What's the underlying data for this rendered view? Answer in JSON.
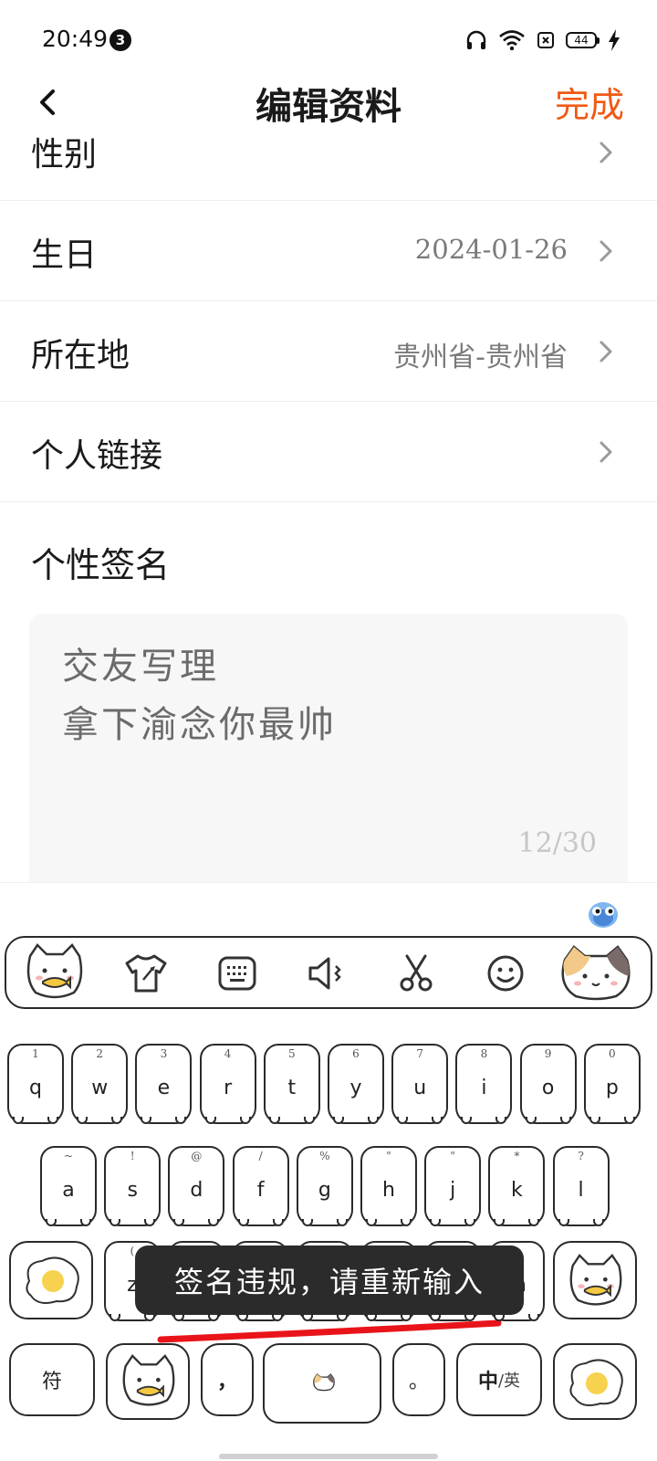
{
  "status_bar": {
    "time": "20:49",
    "notification_count": "3",
    "battery": "44",
    "icons": [
      "headphones-icon",
      "wifi-icon",
      "sim-card-icon",
      "battery-icon",
      "charging-bolt-icon"
    ]
  },
  "header": {
    "title": "编辑资料",
    "done_label": "完成",
    "accent_color": "#f05a14"
  },
  "rows": [
    {
      "label": "性别",
      "value": ""
    },
    {
      "label": "生日",
      "value": "2024-01-26"
    },
    {
      "label": "所在地",
      "value": "贵州省-贵州省"
    },
    {
      "label": "个人链接",
      "value": ""
    }
  ],
  "signature": {
    "label": "个性签名",
    "text": "交友写理\n拿下渝念你最帅",
    "counter": "12/30"
  },
  "keyboard": {
    "toolbar_icons": [
      "cat-fish-sticker-icon",
      "skin-theme-icon",
      "keyboard-icon",
      "voice-icon",
      "scissors-icon",
      "emoji-icon",
      "calico-cat-sticker-icon"
    ],
    "row1": [
      {
        "hint": "1",
        "key": "q"
      },
      {
        "hint": "2",
        "key": "w"
      },
      {
        "hint": "3",
        "key": "e"
      },
      {
        "hint": "4",
        "key": "r"
      },
      {
        "hint": "5",
        "key": "t"
      },
      {
        "hint": "6",
        "key": "y"
      },
      {
        "hint": "7",
        "key": "u"
      },
      {
        "hint": "8",
        "key": "i"
      },
      {
        "hint": "9",
        "key": "o"
      },
      {
        "hint": "0",
        "key": "p"
      }
    ],
    "row2": [
      {
        "hint": "~",
        "key": "a"
      },
      {
        "hint": "!",
        "key": "s"
      },
      {
        "hint": "@",
        "key": "d"
      },
      {
        "hint": "/",
        "key": "f"
      },
      {
        "hint": "%",
        "key": "g"
      },
      {
        "hint": "\"",
        "key": "h"
      },
      {
        "hint": "\"",
        "key": "j"
      },
      {
        "hint": "*",
        "key": "k"
      },
      {
        "hint": "?",
        "key": "l"
      }
    ],
    "row3": [
      {
        "hint": "(",
        "key": "z"
      },
      {
        "hint": "",
        "key": ""
      },
      {
        "hint": "",
        "key": ""
      },
      {
        "hint": "",
        "key": ""
      },
      {
        "hint": "",
        "key": ""
      },
      {
        "hint": "",
        "key": ""
      },
      {
        "hint": "",
        "key": "m"
      }
    ],
    "symbols_label": "符",
    "comma_label": "，",
    "period_label": "。",
    "lang_label_cn": "中",
    "lang_label_sep": "/英"
  },
  "toast": {
    "message": "签名违规，请重新输入"
  }
}
